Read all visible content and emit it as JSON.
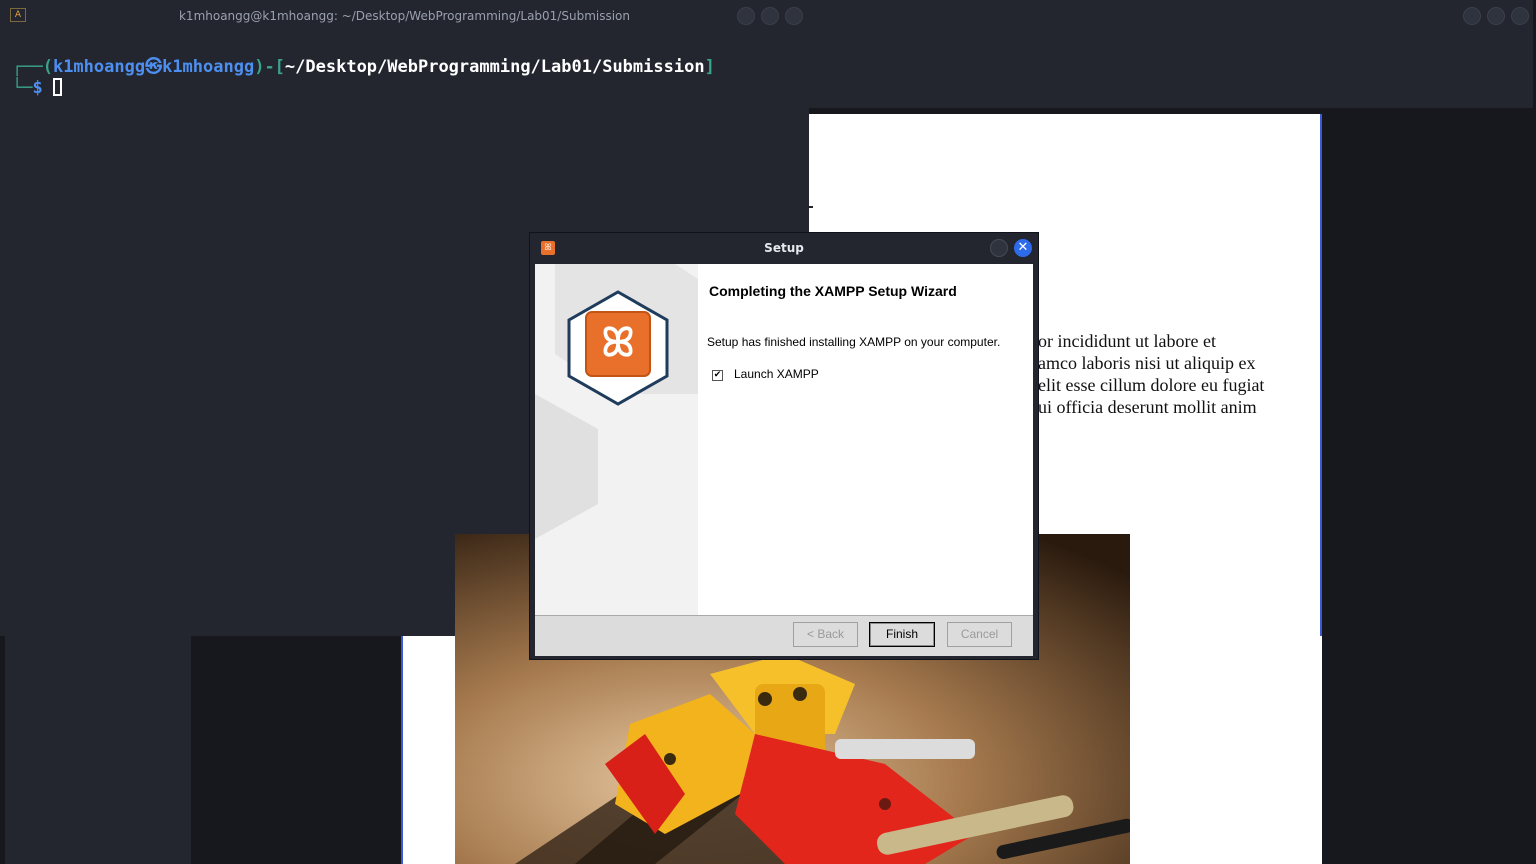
{
  "terminal": {
    "title": "k1mhoangg@k1mhoangg: ~/Desktop/WebProgramming/Lab01/Submission",
    "app_icon": "A",
    "prompt": {
      "corner_top": "┌──(",
      "user": "k1mhoangg",
      "at_symbol": "㉿",
      "host": "k1mhoangg",
      "sep_open": ")-[",
      "path": "~/Desktop/WebProgramming/Lab01/Submission",
      "sep_close": "]",
      "corner_bottom": "└─",
      "dollar": "$"
    }
  },
  "browser": {
    "lorem_lines": [
      "or incididunt ut labore et",
      "amco laboris nisi ut aliquip ex",
      "elit esse cillum dolore eu fugiat",
      "ui officia deserunt mollit anim"
    ]
  },
  "dialog": {
    "title": "Setup",
    "heading": "Completing the XAMPP Setup Wizard",
    "message": "Setup has finished installing XAMPP on your computer.",
    "checkbox_label": "Launch XAMPP",
    "checkbox_checked": true,
    "checkmark": "✔",
    "close_glyph": "✕",
    "buttons": {
      "back": "< Back",
      "finish": "Finish",
      "cancel": "Cancel"
    },
    "logo": "xampp-logo",
    "brand_color": "#e8702a"
  },
  "colors": {
    "terminal_bg": "#23262f",
    "accent_blue": "#4d8ff0",
    "accent_teal": "#3aa38c",
    "close_blue": "#2d6bea"
  }
}
